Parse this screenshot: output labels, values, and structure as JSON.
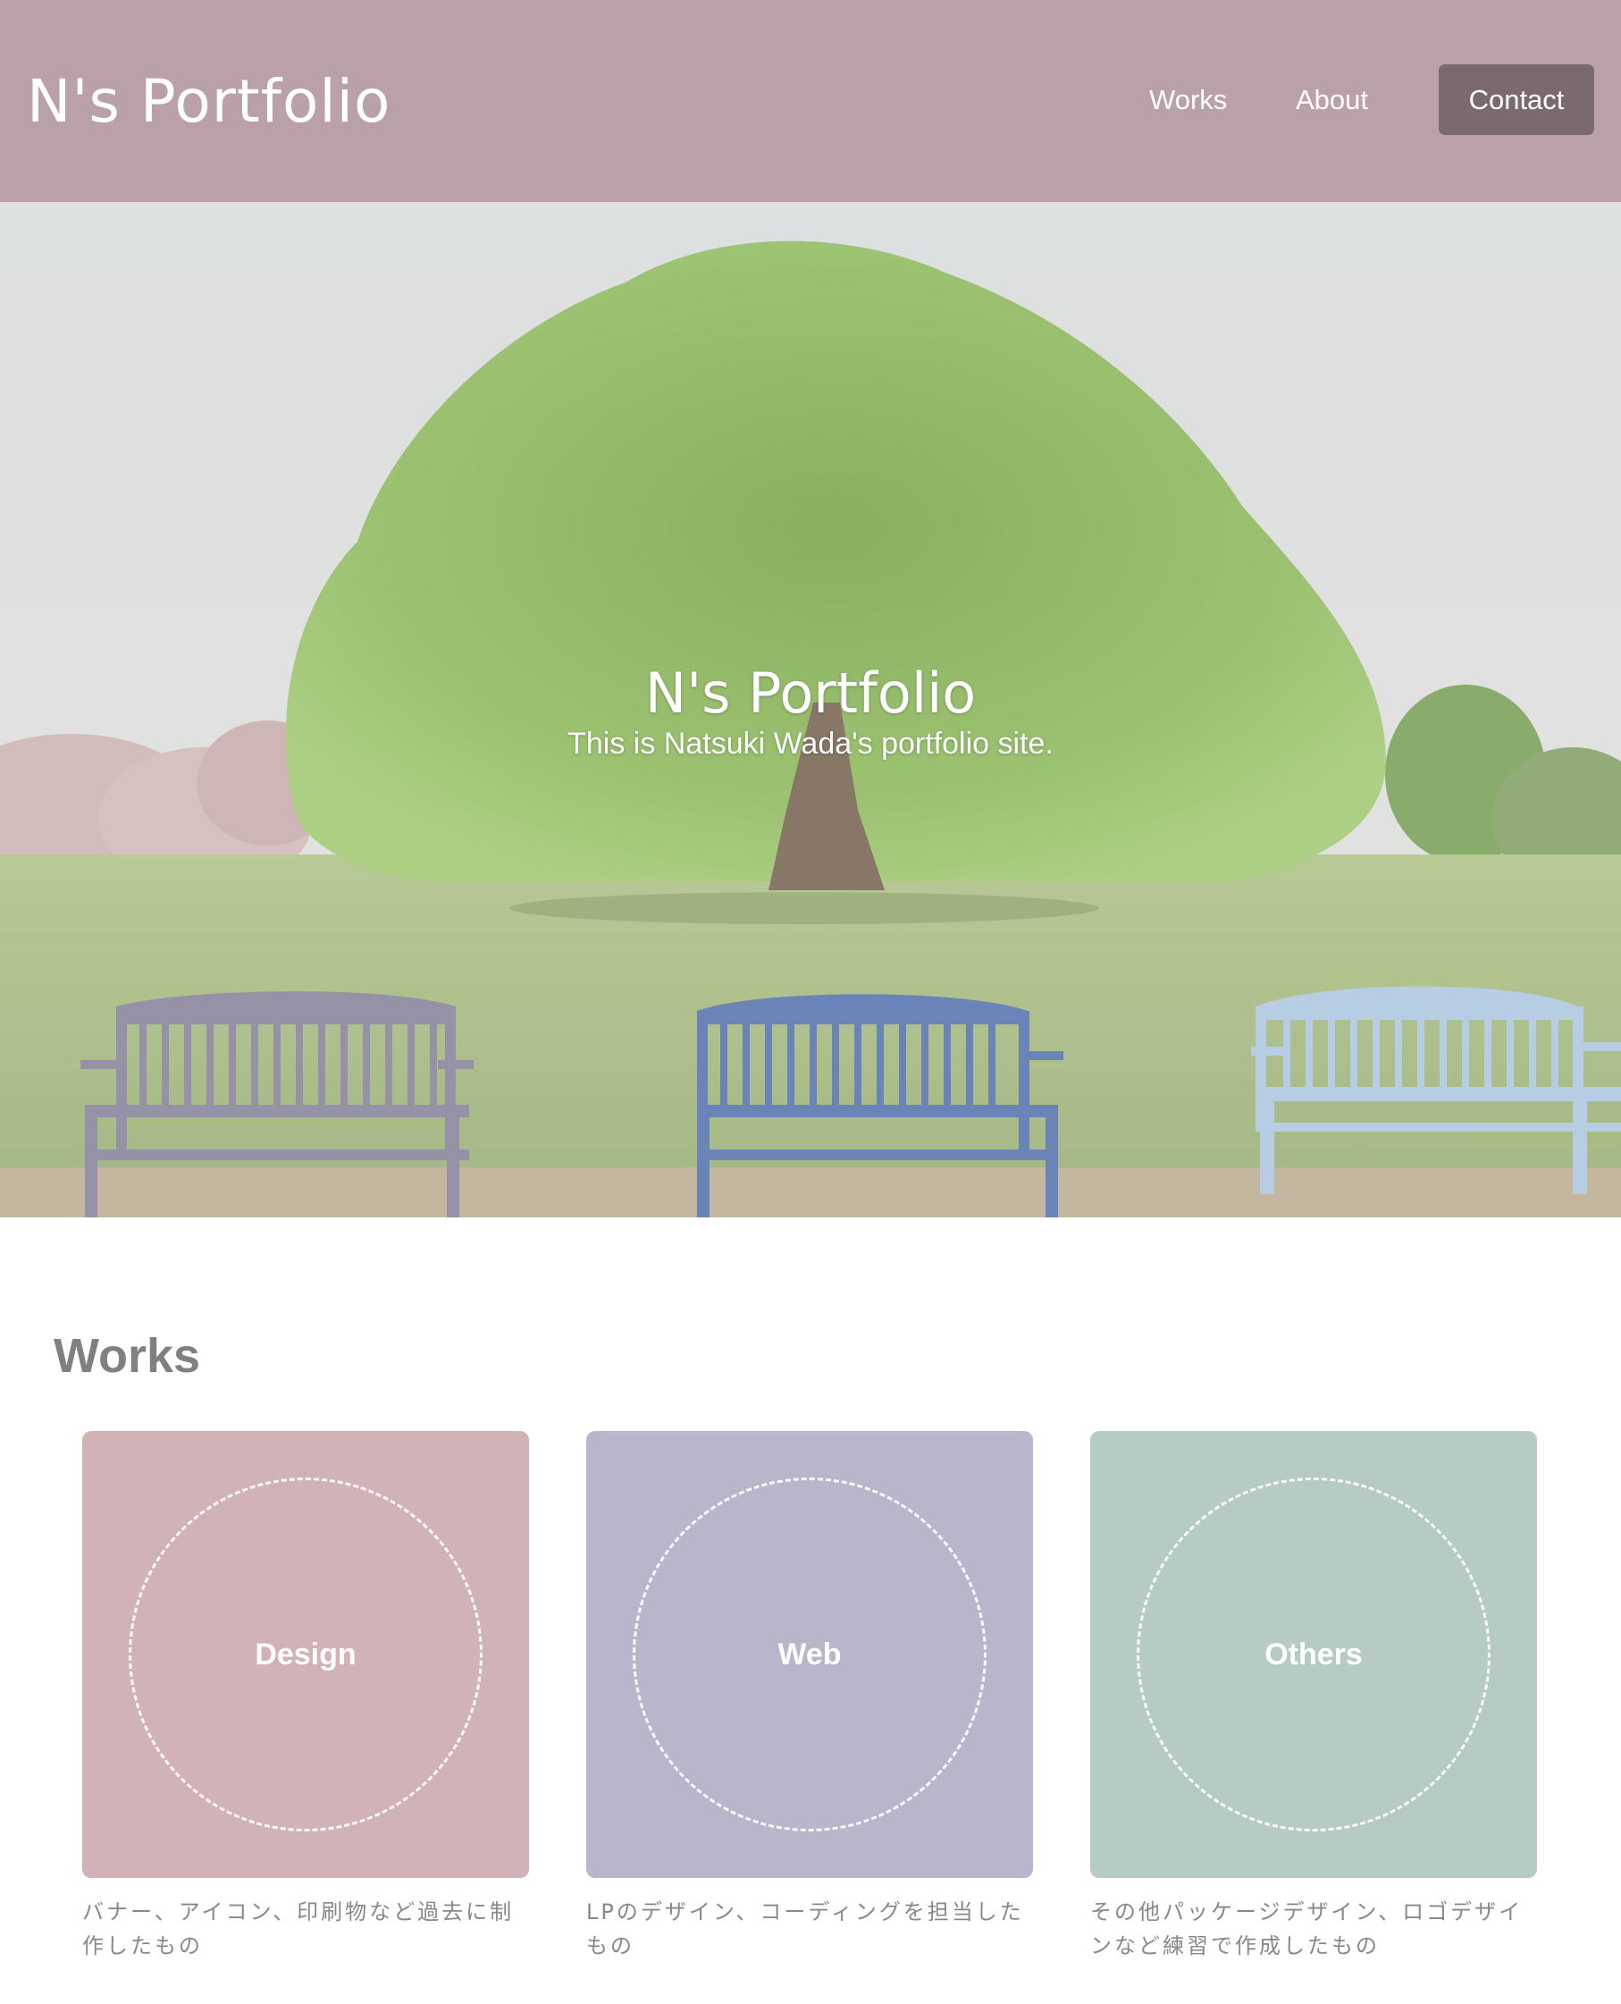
{
  "header": {
    "brand": "N's Portfolio",
    "nav": {
      "works": "Works",
      "about": "About",
      "contact": "Contact"
    },
    "colors": {
      "background": "#b9a1a7",
      "contact_button": "#7a6a70"
    }
  },
  "hero": {
    "image": "park-tree-with-three-benches",
    "title": "N's Portfolio",
    "subtitle": "This is Natsuki Wada's portfolio site."
  },
  "works": {
    "title": "Works",
    "cards": [
      {
        "label": "Design",
        "color": "#d1b2b7",
        "description": "バナー、アイコン、印刷物など過去に制作したもの"
      },
      {
        "label": "Web",
        "color": "#b9b6cb",
        "description": "LPのデザイン、コーディングを担当したもの"
      },
      {
        "label": "Others",
        "color": "#b6cbc2",
        "description": "その他パッケージデザイン、ロゴデザインなど練習で作成したもの"
      }
    ]
  }
}
